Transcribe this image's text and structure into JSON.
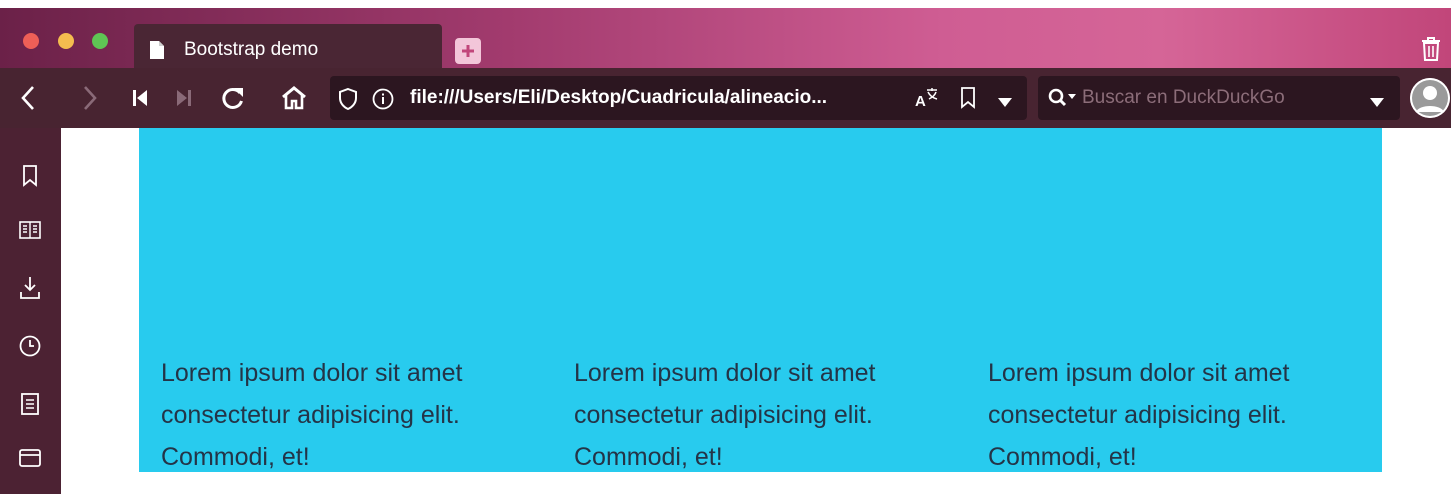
{
  "browser": {
    "tab_title": "Bootstrap demo",
    "url": "file:///Users/Eli/Desktop/Cuadricula/alineacio...",
    "search_placeholder": "Buscar en DuckDuckGo"
  },
  "page": {
    "columns": [
      {
        "text_line1": "Lorem ipsum dolor sit amet",
        "text_line2": "consectetur adipisicing elit.",
        "text_line3": "Commodi, et!"
      },
      {
        "text_line1": "Lorem ipsum dolor sit amet",
        "text_line2": "consectetur adipisicing elit.",
        "text_line3": "Commodi, et!"
      },
      {
        "text_line1": "Lorem ipsum dolor sit amet",
        "text_line2": "consectetur adipisicing elit.",
        "text_line3": "Commodi, et!"
      }
    ]
  },
  "colors": {
    "content_background": "#28cbee",
    "toolbar_background": "#482431",
    "sidebar_background": "#4c2233"
  }
}
